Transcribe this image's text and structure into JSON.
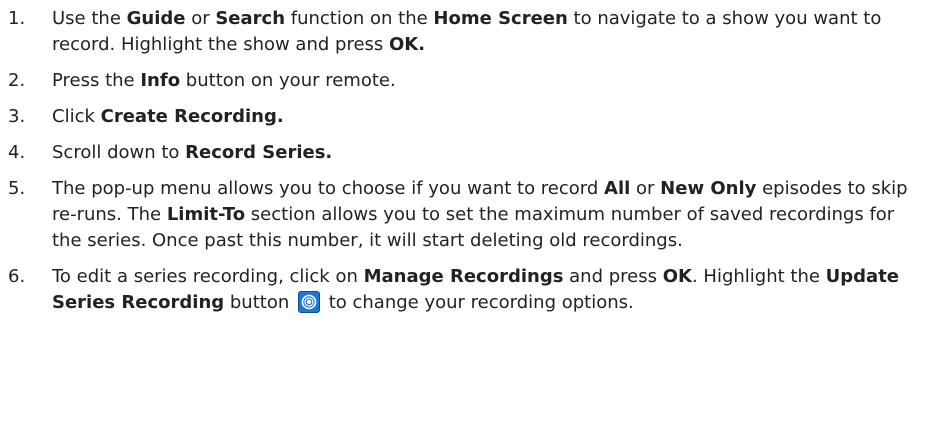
{
  "steps": [
    {
      "number": "1.",
      "parts": [
        {
          "t": "Use the ",
          "b": false
        },
        {
          "t": "Guide",
          "b": true
        },
        {
          "t": " or ",
          "b": false
        },
        {
          "t": "Search",
          "b": true
        },
        {
          "t": " function on the ",
          "b": false
        },
        {
          "t": "Home Screen",
          "b": true
        },
        {
          "t": " to navigate to a show you want to record. Highlight the show and press ",
          "b": false
        },
        {
          "t": "OK.",
          "b": true
        }
      ]
    },
    {
      "number": "2.",
      "parts": [
        {
          "t": "Press the ",
          "b": false
        },
        {
          "t": "Info",
          "b": true
        },
        {
          "t": " button on your remote.",
          "b": false
        }
      ]
    },
    {
      "number": "3.",
      "parts": [
        {
          "t": "Click ",
          "b": false
        },
        {
          "t": "Create Recording.",
          "b": true
        }
      ]
    },
    {
      "number": "4.",
      "parts": [
        {
          "t": "Scroll down to ",
          "b": false
        },
        {
          "t": "Record Series.",
          "b": true
        }
      ]
    },
    {
      "number": "5.",
      "parts": [
        {
          "t": "The pop-up menu allows you to choose if you want to record ",
          "b": false
        },
        {
          "t": "All",
          "b": true
        },
        {
          "t": " or ",
          "b": false
        },
        {
          "t": "New Only",
          "b": true
        },
        {
          "t": " episodes to skip re-runs. The ",
          "b": false
        },
        {
          "t": "Limit-To",
          "b": true
        },
        {
          "t": " section allows you to set the maximum number of saved recordings for the series. Once past this number, it will start deleting old recordings.",
          "b": false
        }
      ]
    },
    {
      "number": "6.",
      "parts": [
        {
          "t": "To edit a series recording, click on ",
          "b": false
        },
        {
          "t": "Manage Recordings",
          "b": true
        },
        {
          "t": " and press ",
          "b": false
        },
        {
          "t": "OK",
          "b": true
        },
        {
          "t": ". Highlight the ",
          "b": false
        },
        {
          "t": "Update Series Recording",
          "b": true
        },
        {
          "t": " button ",
          "b": false
        },
        {
          "icon": "update-series-recording-icon"
        },
        {
          "t": " to change your recording options.",
          "b": false
        }
      ]
    }
  ],
  "colors": {
    "text": "#222222",
    "icon_bg": "#1e78d2"
  }
}
